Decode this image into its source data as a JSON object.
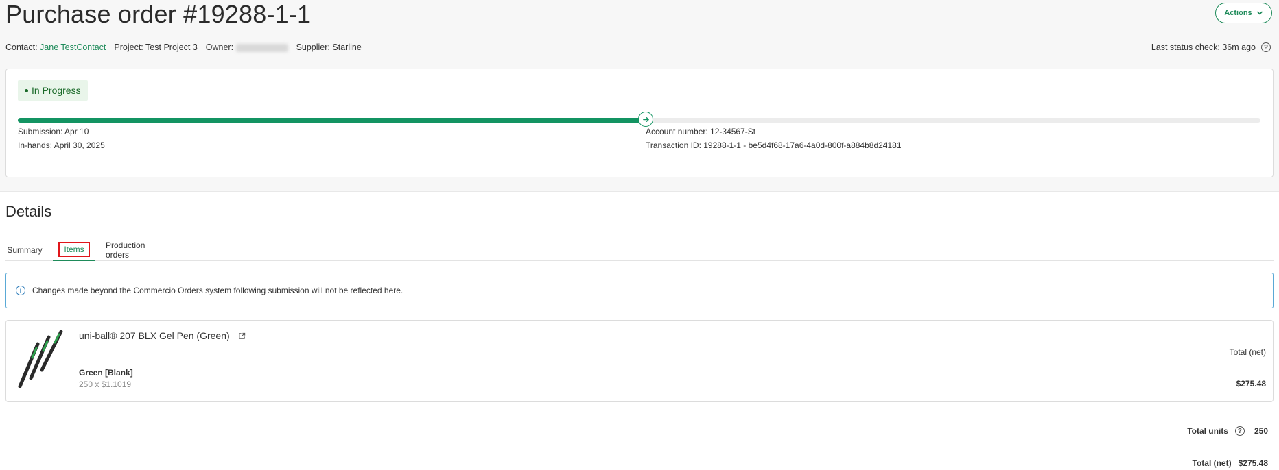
{
  "header": {
    "title": "Purchase order #19288-1-1",
    "actions_label": "Actions"
  },
  "meta": {
    "contact_label": "Contact:",
    "contact_name": "Jane TestContact",
    "project_label": "Project:",
    "project_value": "Test Project 3",
    "owner_label": "Owner:",
    "supplier_label": "Supplier:",
    "supplier_value": "Starline",
    "last_status_check": "Last status check: 36m ago"
  },
  "status": {
    "badge": "In Progress",
    "progress_percent": 50.5,
    "submission": "Submission: Apr 10",
    "in_hands": "In-hands: April 30, 2025",
    "account_number": "Account number: 12-34567-St",
    "transaction_id": "Transaction ID: 19288-1-1 - be5d4f68-17a6-4a0d-800f-a884b8d24181"
  },
  "details": {
    "title": "Details",
    "tabs": [
      {
        "label": "Summary"
      },
      {
        "label": "Items"
      },
      {
        "label": "Production orders"
      }
    ],
    "active_tab": "Items"
  },
  "info_banner": {
    "text": "Changes made beyond the Commercio Orders system following submission will not be reflected here."
  },
  "item": {
    "title": "uni-ball® 207 BLX Gel Pen (Green)",
    "total_header": "Total (net)",
    "variant_name": "Green [Blank]",
    "variant_qty": "250 x $1.1019",
    "variant_total": "$275.48"
  },
  "totals": {
    "units_label": "Total units",
    "units_value": "250",
    "net_label": "Total (net)",
    "net_value": "$275.48"
  },
  "colors": {
    "brand_green": "#1e8b5a",
    "progress_green": "#139462",
    "badge_bg": "#e9f5ea",
    "highlight_red": "#e0161b",
    "info_blue": "#5aa9d6"
  }
}
